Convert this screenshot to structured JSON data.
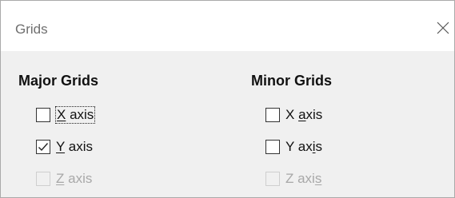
{
  "window": {
    "title": "Grids"
  },
  "major": {
    "title": "Major Grids",
    "options": [
      {
        "pre": "",
        "key": "X",
        "post": " axis",
        "checked": false,
        "enabled": true
      },
      {
        "pre": "",
        "key": "Y",
        "post": " axis",
        "checked": true,
        "enabled": true
      },
      {
        "pre": "",
        "key": "Z",
        "post": " axis",
        "checked": false,
        "enabled": false
      }
    ]
  },
  "minor": {
    "title": "Minor Grids",
    "options": [
      {
        "pre": "X ",
        "key": "a",
        "post": "xis",
        "checked": false,
        "enabled": true
      },
      {
        "pre": "Y ax",
        "key": "i",
        "post": "s",
        "checked": false,
        "enabled": true
      },
      {
        "pre": "Z axi",
        "key": "s",
        "post": "",
        "checked": false,
        "enabled": false
      }
    ]
  }
}
